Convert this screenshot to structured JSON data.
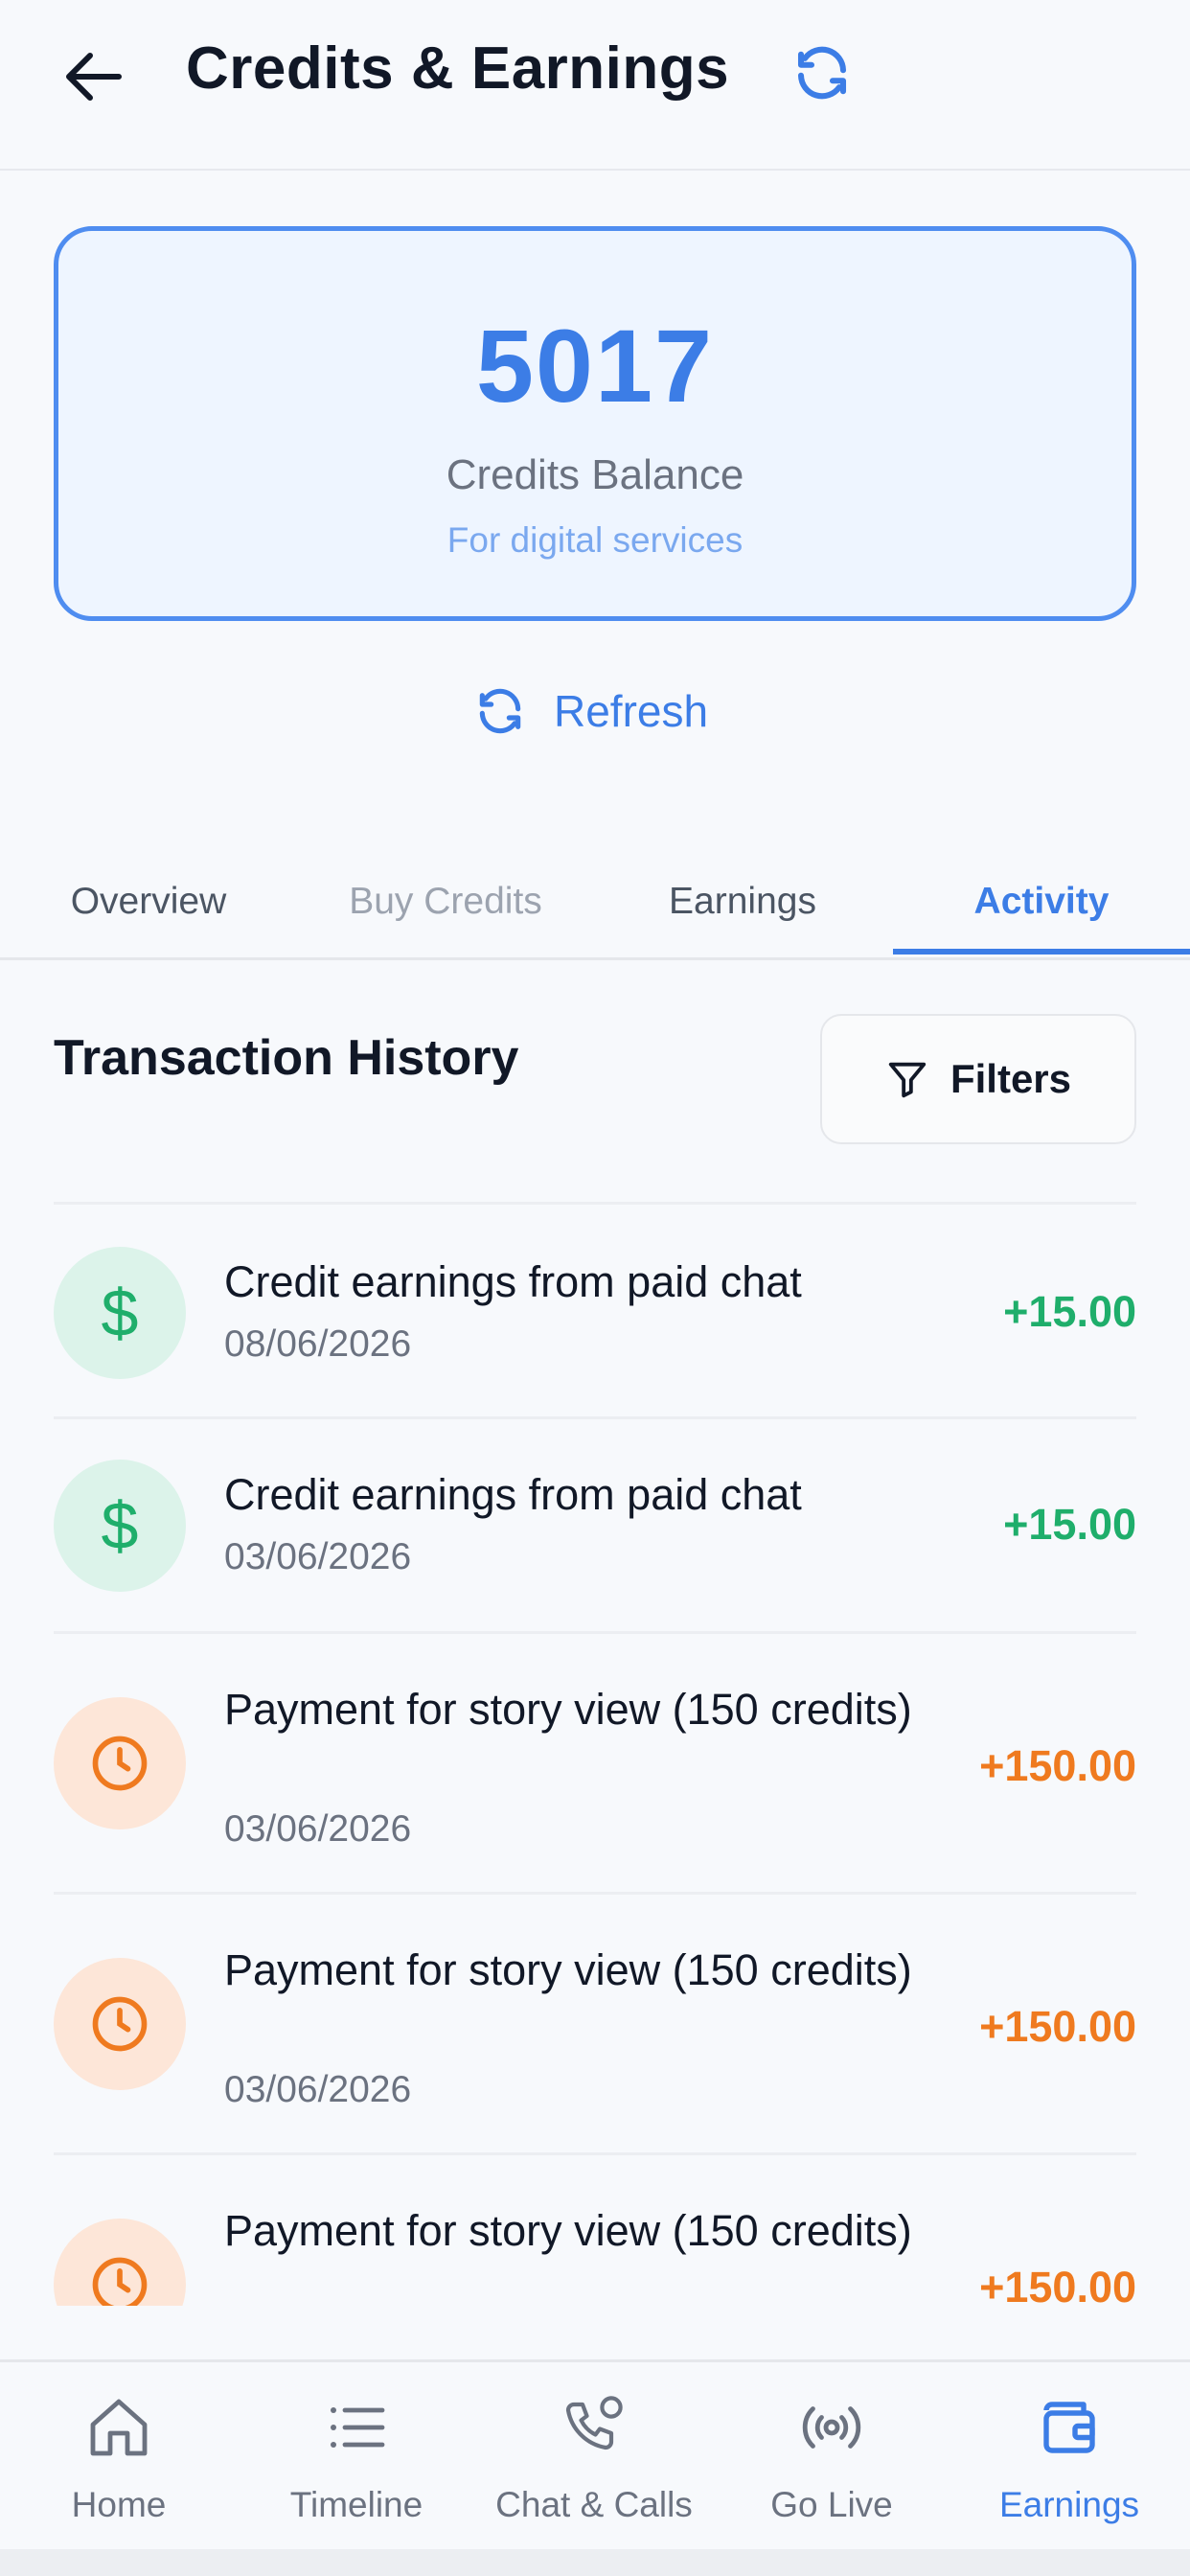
{
  "header": {
    "title": "Credits & Earnings"
  },
  "balance": {
    "value": "5017",
    "label": "Credits Balance",
    "sub": "For digital services"
  },
  "refresh": {
    "label": "Refresh"
  },
  "tabs": [
    {
      "label": "Overview",
      "state": "normal"
    },
    {
      "label": "Buy Credits",
      "state": "disabled"
    },
    {
      "label": "Earnings",
      "state": "normal"
    },
    {
      "label": "Activity",
      "state": "active"
    }
  ],
  "history": {
    "title": "Transaction History",
    "filters_label": "Filters",
    "items": [
      {
        "title": "Credit earnings from paid chat",
        "date": "08/06/2026",
        "amount": "+15.00",
        "icon": "dollar-icon",
        "tone": "green"
      },
      {
        "title": "Credit earnings from paid chat",
        "date": "03/06/2026",
        "amount": "+15.00",
        "icon": "dollar-icon",
        "tone": "green"
      },
      {
        "title": "Payment for story view (150 credits)",
        "date": "03/06/2026",
        "amount": "+150.00",
        "icon": "clock-icon",
        "tone": "orange"
      },
      {
        "title": "Payment for story view (150 credits)",
        "date": "03/06/2026",
        "amount": "+150.00",
        "icon": "clock-icon",
        "tone": "orange"
      },
      {
        "title": "Payment for story view (150 credits)",
        "date": "",
        "amount": "+150.00",
        "icon": "clock-icon",
        "tone": "orange"
      }
    ]
  },
  "nav": [
    {
      "label": "Home",
      "icon": "home-icon"
    },
    {
      "label": "Timeline",
      "icon": "list-icon"
    },
    {
      "label": "Chat & Calls",
      "icon": "phone-chat-icon"
    },
    {
      "label": "Go Live",
      "icon": "broadcast-icon"
    },
    {
      "label": "Earnings",
      "icon": "wallet-icon",
      "active": true
    }
  ],
  "colors": {
    "accent": "#3c7de6",
    "positive": "#1fae6b",
    "story": "#ef7a1f"
  }
}
